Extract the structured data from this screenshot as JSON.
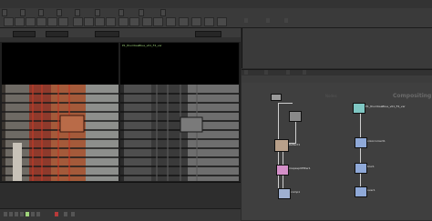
{
  "shelf": {
    "tabs": [
      "",
      "",
      "",
      "",
      "",
      "",
      "",
      "",
      ""
    ]
  },
  "viewer": {
    "fields": [
      "",
      "",
      "",
      ""
    ],
    "left_label": "",
    "right_label": "P1_thumbsaBlue_v01_F4_ver"
  },
  "right_panel": {
    "tabs": [
      "",
      "",
      ""
    ],
    "lower_tabs": [
      "",
      "",
      "",
      ""
    ],
    "network_title": "Compositing",
    "network_watermark": "Nodes"
  },
  "nodes": [
    {
      "label": ""
    },
    {
      "label": "P1_thumbsaBlue_v01_F4_ver"
    },
    {
      "label": "Reflect1"
    },
    {
      "label": "colorcorrect1"
    },
    {
      "label": "mapasplitfilter1"
    },
    {
      "label": "blur1"
    },
    {
      "label": "comp1"
    },
    {
      "label": "over1"
    }
  ],
  "colors": {
    "accent_green": "#9fd47a",
    "node_pink": "#d48fc8",
    "node_teal": "#7fc7c3",
    "node_blue": "#8fa9d8"
  }
}
